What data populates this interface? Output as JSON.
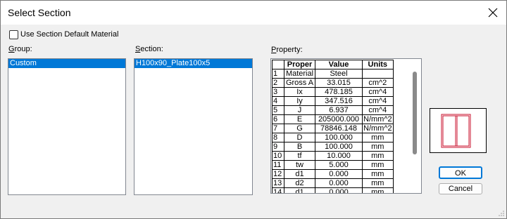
{
  "window": {
    "title": "Select Section"
  },
  "checkbox": {
    "label": "Use Section Default Material",
    "checked": false
  },
  "group": {
    "label_first": "G",
    "label_rest": "roup:",
    "items": [
      "Custom"
    ],
    "selected_index": 0
  },
  "section": {
    "label_first": "S",
    "label_rest": "ection:",
    "items": [
      "H100x90_Plate100x5"
    ],
    "selected_index": 0
  },
  "property": {
    "label_first": "P",
    "label_rest": "roperty:",
    "headers": [
      "",
      "Proper",
      "Value",
      "Units"
    ],
    "rows": [
      [
        "1",
        "Material",
        "Steel",
        ""
      ],
      [
        "2",
        "Gross A",
        "33.015",
        "cm^2"
      ],
      [
        "3",
        "Ix",
        "478.185",
        "cm^4"
      ],
      [
        "4",
        "Iy",
        "347.516",
        "cm^4"
      ],
      [
        "5",
        "J",
        "6.937",
        "cm^4"
      ],
      [
        "6",
        "E",
        "205000.000",
        "N/mm^2"
      ],
      [
        "7",
        "G",
        "78846.148",
        "N/mm^2"
      ],
      [
        "8",
        "D",
        "100.000",
        "mm"
      ],
      [
        "9",
        "B",
        "100.000",
        "mm"
      ],
      [
        "10",
        "tf",
        "10.000",
        "mm"
      ],
      [
        "11",
        "tw",
        "5.000",
        "mm"
      ],
      [
        "12",
        "d1",
        "0.000",
        "mm"
      ],
      [
        "13",
        "d2",
        "0.000",
        "mm"
      ],
      [
        "14",
        "d1",
        "0.000",
        "mm"
      ]
    ]
  },
  "buttons": {
    "ok": "OK",
    "cancel": "Cancel"
  },
  "colors": {
    "accent": "#0078d7",
    "preview_stroke": "#c8102e"
  },
  "icons": {
    "close": "close-icon",
    "preview": "section-preview-icon"
  }
}
